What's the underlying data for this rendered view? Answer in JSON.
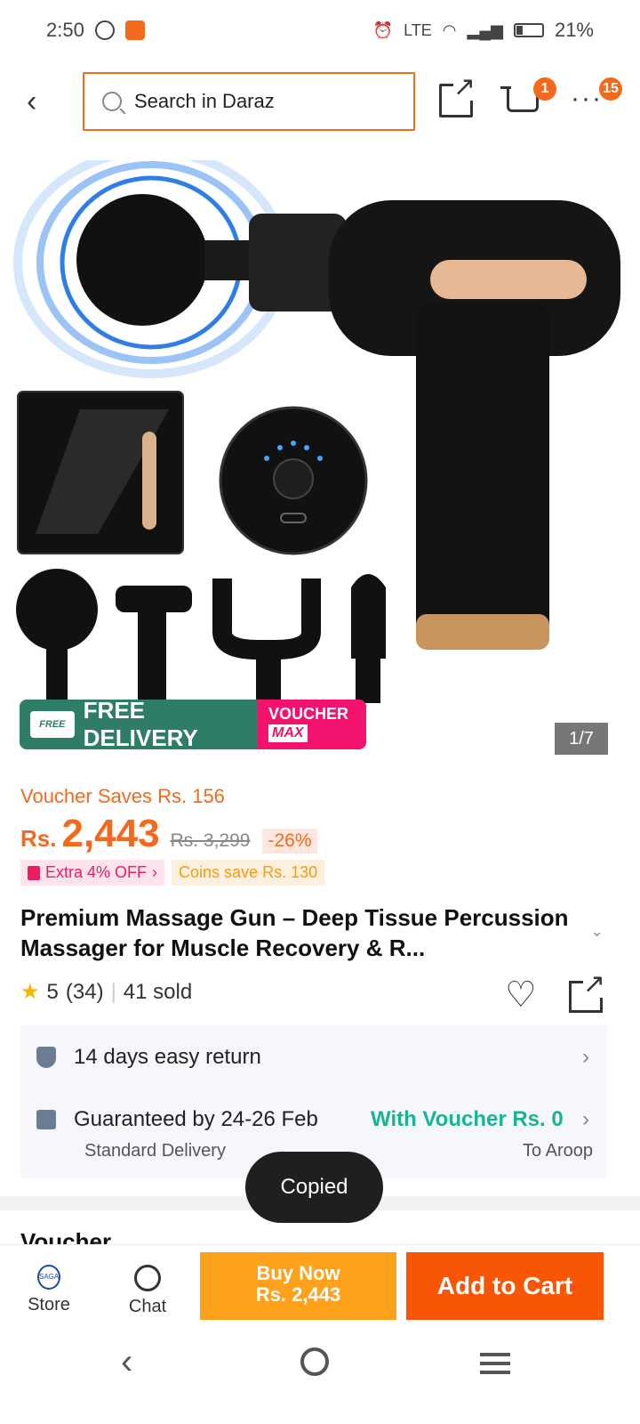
{
  "status": {
    "time": "2:50",
    "battery": "21%",
    "network": "LTE"
  },
  "header": {
    "search_placeholder": "Search in Daraz",
    "cart_count": "1",
    "more_count": "15"
  },
  "banner": {
    "free_tag": "FREE",
    "delivery_label": "FREE DELIVERY",
    "voucher_label": "VOUCHER",
    "voucher_max": "MAX",
    "image_counter": "1/7"
  },
  "price": {
    "voucher_saves": "Voucher Saves Rs. 156",
    "currency": "Rs.",
    "value": "2,443",
    "old_price": "Rs. 3,299",
    "discount": "-26%",
    "extra_off": "Extra 4% OFF",
    "coins": "Coins save Rs. 130"
  },
  "product": {
    "title": "Premium Massage Gun – Deep Tissue Percussion Massager for Muscle Recovery & R...",
    "rating": "5",
    "reviews": "(34)",
    "sold": "41 sold"
  },
  "info": {
    "return": "14 days easy return",
    "guarantee": "Guaranteed by 24-26 Feb",
    "voucher_delivery": "With Voucher Rs. 0",
    "delivery_type": "Standard Delivery",
    "deliver_to": "To Aroop"
  },
  "section": {
    "partial_heading": "Voucher"
  },
  "toast": {
    "text": "Copied"
  },
  "bottom": {
    "store": "Store",
    "store_logo": "SAGA",
    "chat": "Chat",
    "buy_now_line1": "Buy Now",
    "buy_now_line2": "Rs. 2,443",
    "add_to_cart": "Add to Cart"
  },
  "colors": {
    "brand": "#f36a1c",
    "buy": "#fda21a",
    "cart": "#f85606",
    "green": "#1ab394"
  },
  "icons": [
    "back-icon",
    "search-icon",
    "share-icon",
    "cart-icon",
    "more-icon",
    "star-icon",
    "heart-icon",
    "shield-icon",
    "gift-icon",
    "chat-icon"
  ]
}
